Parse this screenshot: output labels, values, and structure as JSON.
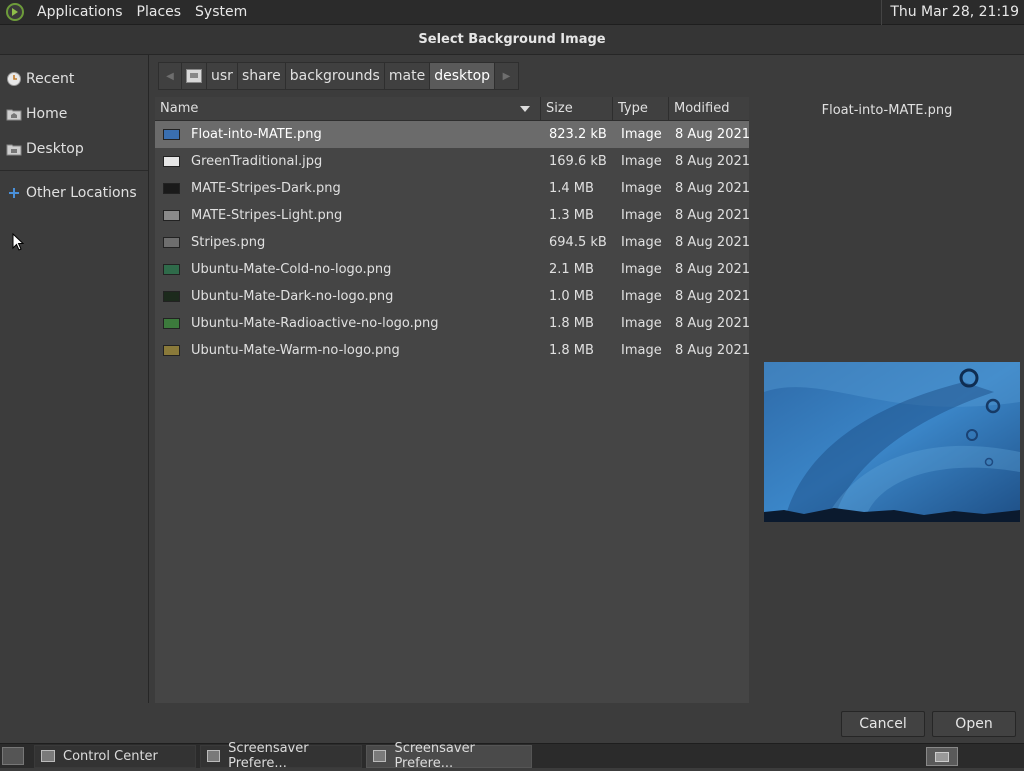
{
  "top_panel": {
    "menus": [
      "Applications",
      "Places",
      "System"
    ],
    "clock": "Thu Mar 28, 21:19"
  },
  "dialog": {
    "title": "Select Background Image"
  },
  "sidebar": {
    "items": [
      {
        "label": "Recent",
        "icon": "recent-icon"
      },
      {
        "label": "Home",
        "icon": "home-folder-icon"
      },
      {
        "label": "Desktop",
        "icon": "desktop-folder-icon"
      },
      {
        "label": "Other Locations",
        "icon": "plus-icon"
      }
    ]
  },
  "pathbar": {
    "segments": [
      "usr",
      "share",
      "backgrounds",
      "mate",
      "desktop"
    ],
    "active": "desktop"
  },
  "file_list": {
    "columns": {
      "name": "Name",
      "size": "Size",
      "type": "Type",
      "modified": "Modified"
    },
    "rows": [
      {
        "name": "Float-into-MATE.png",
        "size": "823.2 kB",
        "type": "Image",
        "modified": "8 Aug 2021",
        "selected": true,
        "thumb": "#3a6fb0"
      },
      {
        "name": "GreenTraditional.jpg",
        "size": "169.6 kB",
        "type": "Image",
        "modified": "8 Aug 2021",
        "selected": false,
        "thumb": "#e6e6e6"
      },
      {
        "name": "MATE-Stripes-Dark.png",
        "size": "1.4 MB",
        "type": "Image",
        "modified": "8 Aug 2021",
        "selected": false,
        "thumb": "#1a1a1a"
      },
      {
        "name": "MATE-Stripes-Light.png",
        "size": "1.3 MB",
        "type": "Image",
        "modified": "8 Aug 2021",
        "selected": false,
        "thumb": "#8a8a8a"
      },
      {
        "name": "Stripes.png",
        "size": "694.5 kB",
        "type": "Image",
        "modified": "8 Aug 2021",
        "selected": false,
        "thumb": "#6e6e6e"
      },
      {
        "name": "Ubuntu-Mate-Cold-no-logo.png",
        "size": "2.1 MB",
        "type": "Image",
        "modified": "8 Aug 2021",
        "selected": false,
        "thumb": "#2f6b4a"
      },
      {
        "name": "Ubuntu-Mate-Dark-no-logo.png",
        "size": "1.0 MB",
        "type": "Image",
        "modified": "8 Aug 2021",
        "selected": false,
        "thumb": "#1c2a1c"
      },
      {
        "name": "Ubuntu-Mate-Radioactive-no-logo.png",
        "size": "1.8 MB",
        "type": "Image",
        "modified": "8 Aug 2021",
        "selected": false,
        "thumb": "#3c7a3c"
      },
      {
        "name": "Ubuntu-Mate-Warm-no-logo.png",
        "size": "1.8 MB",
        "type": "Image",
        "modified": "8 Aug 2021",
        "selected": false,
        "thumb": "#8a7a3a"
      }
    ]
  },
  "preview": {
    "filename": "Float-into-MATE.png"
  },
  "buttons": {
    "cancel": "Cancel",
    "open": "Open"
  },
  "taskbar": {
    "tasks": [
      {
        "label": "Control Center",
        "active": false
      },
      {
        "label": "Screensaver Prefere...",
        "active": false
      },
      {
        "label": "Screensaver Prefere...",
        "active": true
      }
    ]
  }
}
